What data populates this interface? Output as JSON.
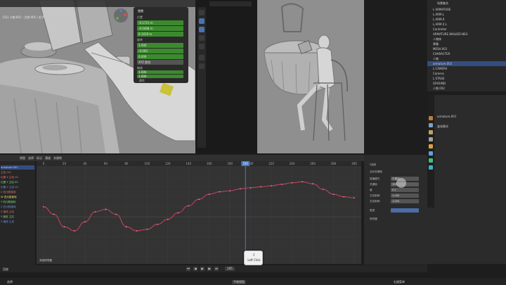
{
  "viewport_left": {
    "header": "(51) 人物.001 : 主控.001 / 右手"
  },
  "npanel": {
    "title": "变换",
    "section_location": "位置",
    "loc_values": [
      "-0.1721 m",
      "-0.0468 m",
      "0.1419 m"
    ],
    "section_rotation": "旋转",
    "rot_values": [
      "1.000",
      "-0.000",
      "0.000",
      "0.000"
    ],
    "rot_mode": "XYZ 欧拉",
    "section_scale": "缩放",
    "scale_values": [
      "1.000",
      "1.000",
      "1.000"
    ],
    "footer": "属性"
  },
  "outliner": {
    "title": "场景集合",
    "rows": [
      {
        "label": "L ARMATURE",
        "selected": false
      },
      {
        "label": "L.ARM.L",
        "selected": false
      },
      {
        "label": "L.ARM.R",
        "selected": false
      },
      {
        "label": "L.ARM.X.L",
        "selected": false
      },
      {
        "label": "Controller",
        "selected": false
      },
      {
        "label": "ARMATURE.WALKER.NEU",
        "selected": false
      },
      {
        "label": "人物体",
        "selected": false
      },
      {
        "label": "骨骼",
        "selected": false
      },
      {
        "label": "MESH.001",
        "selected": false
      },
      {
        "label": "CHARACTER",
        "selected": false
      },
      {
        "label": "人物",
        "selected": false
      },
      {
        "label": "armature.001",
        "selected": true
      },
      {
        "label": "L.CAMERA",
        "selected": false
      },
      {
        "label": "Camera",
        "selected": false
      },
      {
        "label": "L.STAGE",
        "selected": false
      },
      {
        "label": "GROUND",
        "selected": false
      },
      {
        "label": "人物.002",
        "selected": false
      }
    ]
  },
  "props": {
    "object_name": "armature.001",
    "pose_label": "姿态模式"
  },
  "graph_header": {
    "items": [
      "视图",
      "选择",
      "标记",
      "通道",
      "关键帧"
    ]
  },
  "channels": {
    "rows": [
      "armature.001",
      "主控.001",
      "位置 X 主控.00",
      "位置 Y 主控.00",
      "位置 Z 主控.00",
      "X 四元数旋转",
      "W 四元数旋转",
      "Y 四元数旋转",
      "Z 四元数旋转",
      "X 缩放 主控",
      "Y 缩放 主控",
      "Z 缩放 主控"
    ]
  },
  "ruler": {
    "frames": [
      "0",
      "20",
      "40",
      "60",
      "80",
      "100",
      "120",
      "140",
      "160",
      "180",
      "200",
      "220",
      "240",
      "260",
      "280",
      "300"
    ],
    "current_frame": "195"
  },
  "graph": {
    "footer_label": "添加修改器"
  },
  "sidebar": {
    "header": "F曲线",
    "active_label": "活动关键帧",
    "interp_label": "插值模式",
    "interp_value": "贝塞尔",
    "frame_label": "关键帧",
    "frame_value": "195",
    "value_label": "值",
    "value_value": "0.2",
    "left_handle_label": "左控制柄",
    "left_handle_value": "1.000",
    "right_handle_label": "右控制柄",
    "right_handle_value": "1.000",
    "handle_type_label": "类型",
    "modifiers_label": "修改器",
    "add_modifier": "添加修改器"
  },
  "key_overlay": {
    "line1": "F",
    "line2": "Left Click"
  },
  "playback": {
    "label": "回放",
    "frame": "195"
  },
  "status": {
    "left": "选择",
    "middle": "平移视图",
    "right": "右键菜单"
  },
  "chart_data": {
    "type": "line",
    "x": [
      0,
      10,
      20,
      30,
      40,
      50,
      60,
      70,
      80,
      90,
      100,
      110,
      120,
      130,
      140,
      150,
      160,
      170,
      180,
      190,
      200,
      210,
      220,
      230,
      240,
      250,
      260,
      270,
      280,
      290,
      300
    ],
    "series": [
      {
        "values": [
          0.2,
          0.05,
          -0.2,
          -0.28,
          -0.1,
          0.1,
          0.15,
          0.05,
          -0.2,
          -0.28,
          -0.25,
          -0.15,
          -0.05,
          0.08,
          0.22,
          0.35,
          0.45,
          0.5,
          0.52,
          0.56,
          0.58,
          0.6,
          0.62,
          0.65,
          0.68,
          0.7,
          0.66,
          0.55,
          0.45,
          0.4,
          0.38
        ]
      }
    ],
    "ylim": [
      -0.8,
      1.0
    ]
  }
}
